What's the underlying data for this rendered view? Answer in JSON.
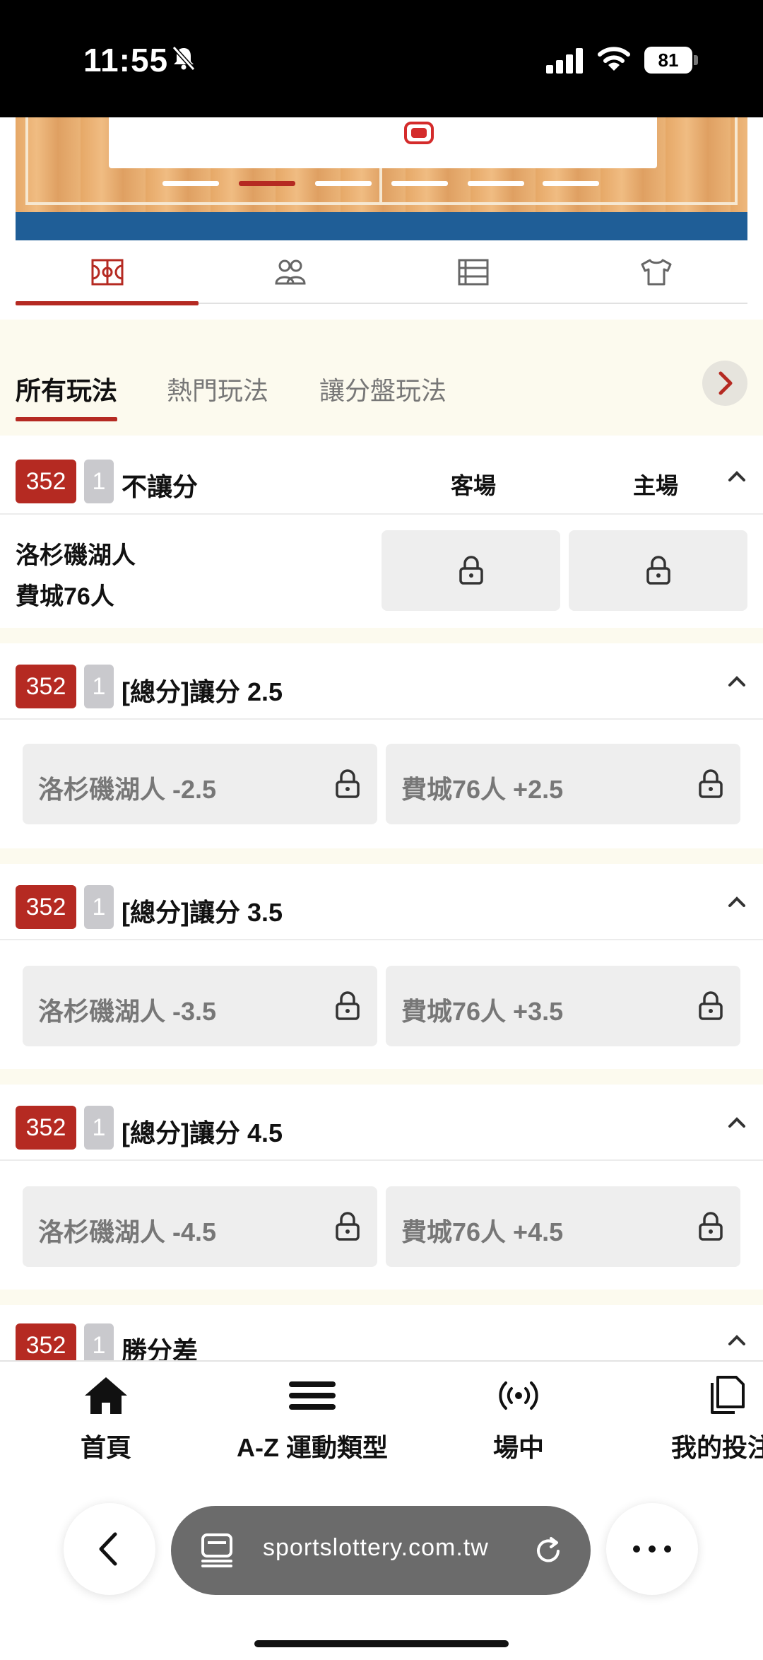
{
  "status_bar": {
    "time": "11:55",
    "battery": "81"
  },
  "icon_tabs": [
    {
      "icon": "basketball-court-icon",
      "active": true
    },
    {
      "icon": "players-icon",
      "active": false
    },
    {
      "icon": "list-icon",
      "active": false
    },
    {
      "icon": "jersey-icon",
      "active": false
    }
  ],
  "market_tabs": [
    "所有玩法",
    "熱門玩法",
    "讓分盤玩法"
  ],
  "sections": [
    {
      "num": "352",
      "sub": "1",
      "title": "不讓分",
      "col_away": "客場",
      "col_home": "主場",
      "teams": [
        "洛杉磯湖人",
        "費城76人"
      ]
    },
    {
      "num": "352",
      "sub": "1",
      "title": "[總分]讓分 2.5",
      "options": [
        "洛杉磯湖人 -2.5",
        "費城76人 +2.5"
      ]
    },
    {
      "num": "352",
      "sub": "1",
      "title": "[總分]讓分 3.5",
      "options": [
        "洛杉磯湖人 -3.5",
        "費城76人 +3.5"
      ]
    },
    {
      "num": "352",
      "sub": "1",
      "title": "[總分]讓分 4.5",
      "options": [
        "洛杉磯湖人 -4.5",
        "費城76人 +4.5"
      ]
    },
    {
      "num": "352",
      "sub": "1",
      "title": "勝分差"
    }
  ],
  "bottom_nav": [
    {
      "label": "首頁",
      "icon": "home-icon"
    },
    {
      "label": "A-Z 運動類型",
      "icon": "menu-icon"
    },
    {
      "label": "場中",
      "icon": "live-broadcast-icon"
    },
    {
      "label": "我的投注",
      "icon": "documents-icon"
    }
  ],
  "browser": {
    "url": "sportslottery.com.tw"
  },
  "colors": {
    "accent": "#b52a22",
    "cream": "#fcfaee",
    "locked_bg": "#eeeeee"
  }
}
